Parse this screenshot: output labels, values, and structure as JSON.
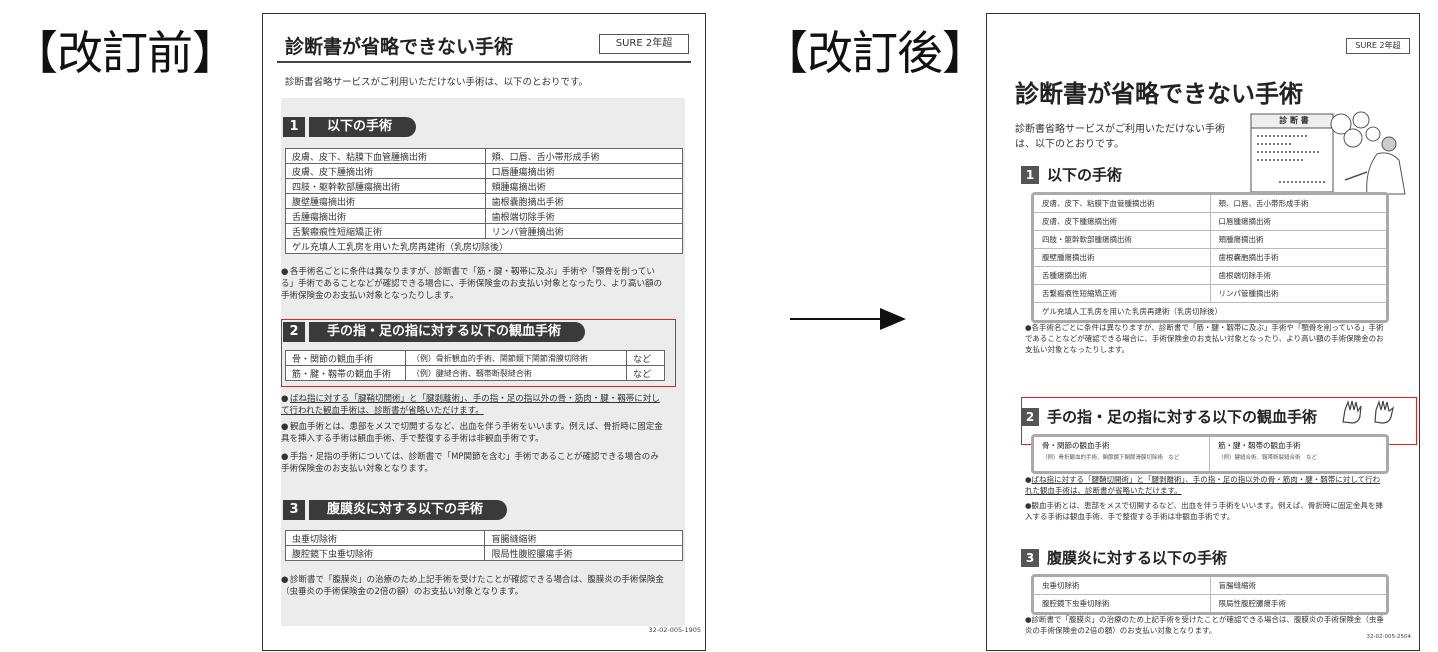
{
  "labels": {
    "before": "【改訂前】",
    "after": "【改訂後】"
  },
  "before": {
    "title": "診断書が省略できない手術",
    "badge": "SURE 2年超",
    "intro": "診断書省略サービスがご利用いただけない手術は、以下のとおりです。",
    "sec1": {
      "num": "1",
      "label": "以下の手術",
      "rows": [
        [
          "皮膚、皮下、粘膜下血管腫摘出術",
          "頬、口唇、舌小帯形成手術"
        ],
        [
          "皮膚、皮下腫摘出術",
          "口唇腫瘍摘出術"
        ],
        [
          "四肢・躯幹軟部腫瘍摘出術",
          "頬腫瘍摘出術"
        ],
        [
          "腹壁腫瘍摘出術",
          "歯根嚢胞摘出手術"
        ],
        [
          "舌腫瘍摘出術",
          "歯根端切除手術"
        ],
        [
          "舌繋瘢痕性短縮矯正術",
          "リンパ管腫摘出術"
        ]
      ],
      "last_row": "ゲル充填人工乳房を用いた乳房再建術（乳房切除後）",
      "note": "各手術名ごとに条件は異なりますが、診断書で「筋・腱・靱帯に及ぶ」手術や「顎骨を削っている」手術であることなどが確認できる場合に、手術保険金のお支払い対象となったり、より高い額の手術保険金のお支払い対象となったりします。"
    },
    "sec2": {
      "num": "2",
      "label": "手の指・足の指に対する以下の観血手術",
      "rows": [
        [
          "骨・関節の観血手術",
          "（例）骨折観血的手術、関節鏡下関節滑膜切除術",
          "など"
        ],
        [
          "筋・腱・靱帯の観血手術",
          "（例）腱縫合術、靱帯断裂縫合術",
          "など"
        ]
      ],
      "note1": "ばね指に対する「腱鞘切開術」と「腱剥離術」、手の指・足の指以外の骨・筋肉・腱・靱帯に対して行われた観血手術は、診断書が省略いただけます。",
      "note2": "観血手術とは、患部をメスで切開するなど、出血を伴う手術をいいます。例えば、骨折時に固定金具を挿入する手術は観血手術、手で整復する手術は非観血手術です。",
      "note3": "手指・足指の手術については、診断書で「MP関節を含む」手術であることが確認できる場合のみ手術保険金のお支払い対象となります。"
    },
    "sec3": {
      "num": "3",
      "label": "腹膜炎に対する以下の手術",
      "rows": [
        [
          "虫垂切除術",
          "盲腸縫縮術"
        ],
        [
          "腹腔鏡下虫垂切除術",
          "限局性腹腔膿瘍手術"
        ]
      ],
      "note": "診断書で「腹膜炎」の治療のため上記手術を受けたことが確認できる場合は、腹膜炎の手術保険金（虫垂炎の手術保険金の2倍の額）のお支払い対象となります。"
    },
    "footer": "32-02-005-1905"
  },
  "after": {
    "title": "診断書が省略できない手術",
    "badge": "SURE 2年超",
    "intro": "診断書省略サービスがご利用いただけない手術は、以下のとおりです。",
    "illustration_label": "診 断 書",
    "sec1": {
      "num": "1",
      "label": "以下の手術",
      "rows": [
        [
          "皮膚、皮下、粘膜下血管腫摘出術",
          "頬、口唇、舌小帯形成手術"
        ],
        [
          "皮膚、皮下腫瘍摘出術",
          "口唇腫瘍摘出術"
        ],
        [
          "四肢・躯幹軟部腫瘍摘出術",
          "頬腫瘍摘出術"
        ],
        [
          "腹壁腫瘍摘出術",
          "歯根嚢胞摘出手術"
        ],
        [
          "舌腫瘍摘出術",
          "歯根端切除手術"
        ],
        [
          "舌繋瘢痕性短縮矯正術",
          "リンパ管腫摘出術"
        ]
      ],
      "last_row": "ゲル充填人工乳房を用いた乳房再建術（乳房切除後）",
      "note": "各手術名ごとに条件は異なりますが、診断書で「筋・腱・靱帯に及ぶ」手術や「顎骨を削っている」手術であることなどが確認できる場合に、手術保険金のお支払い対象となったり、より高い額の手術保険金のお支払い対象となったりします。"
    },
    "sec2": {
      "num": "2",
      "label": "手の指・足の指に対する以下の観血手術",
      "cell1_title": "骨・関節の観血手術",
      "cell1_sub": "（例）骨折観血的手術、関節鏡下関節滑膜切除術　など",
      "cell2_title": "筋・腱・靱帯の観血手術",
      "cell2_sub": "（例）腱縫合術、靱帯断裂縫合術　など",
      "note1": "ばね指に対する「腱鞘切開術」と「腱剥離術」、手の指・足の指以外の骨・筋肉・腱・靱帯に対して行われた観血手術は、診断書が省略いただけます。",
      "note2": "観血手術とは、患部をメスで切開するなど、出血を伴う手術をいいます。例えば、骨折時に固定金具を挿入する手術は観血手術、手で整復する手術は非観血手術です。"
    },
    "sec3": {
      "num": "3",
      "label": "腹膜炎に対する以下の手術",
      "rows": [
        [
          "虫垂切除術",
          "盲腸縫縮術"
        ],
        [
          "腹腔鏡下虫垂切除術",
          "限局性腹腔膿瘍手術"
        ]
      ],
      "note": "診断書で「腹膜炎」の治療のため上記手術を受けたことが確認できる場合は、腹膜炎の手術保険金（虫垂炎の手術保険金の2倍の額）のお支払い対象となります。"
    },
    "footer": "32-02-005-2504"
  },
  "icons": {
    "arrow": "arrow-right-icon",
    "bullet": "●"
  },
  "colors": {
    "highlight": "#dd2222",
    "heading_bg": "#3a3a3a",
    "panel_bg": "#ececec"
  }
}
